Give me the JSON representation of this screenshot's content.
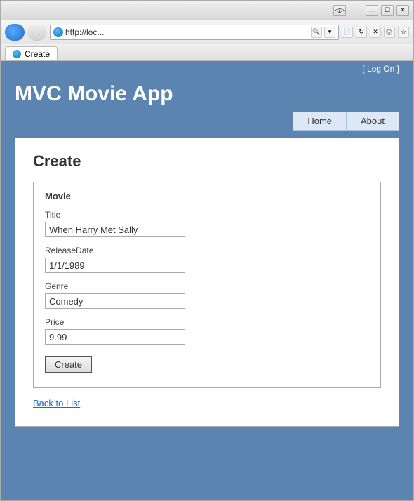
{
  "browser": {
    "address": "http://loc...",
    "tab_title": "Create",
    "title_bar_buttons": [
      "◁▷",
      "—",
      "☐",
      "✕"
    ]
  },
  "header": {
    "log_on_prefix": "[ ",
    "log_on_label": "Log On",
    "log_on_suffix": " ]",
    "site_title": "MVC Movie App",
    "nav": {
      "home_label": "Home",
      "about_label": "About"
    }
  },
  "page": {
    "heading": "Create",
    "form": {
      "box_title": "Movie",
      "fields": [
        {
          "label": "Title",
          "value": "When Harry Met Sally",
          "id": "title"
        },
        {
          "label": "ReleaseDate",
          "value": "1/1/1989",
          "id": "release-date"
        },
        {
          "label": "Genre",
          "value": "Comedy",
          "id": "genre"
        },
        {
          "label": "Price",
          "value": "9.99",
          "id": "price"
        }
      ],
      "submit_label": "Create"
    },
    "back_link_label": "Back to List"
  }
}
